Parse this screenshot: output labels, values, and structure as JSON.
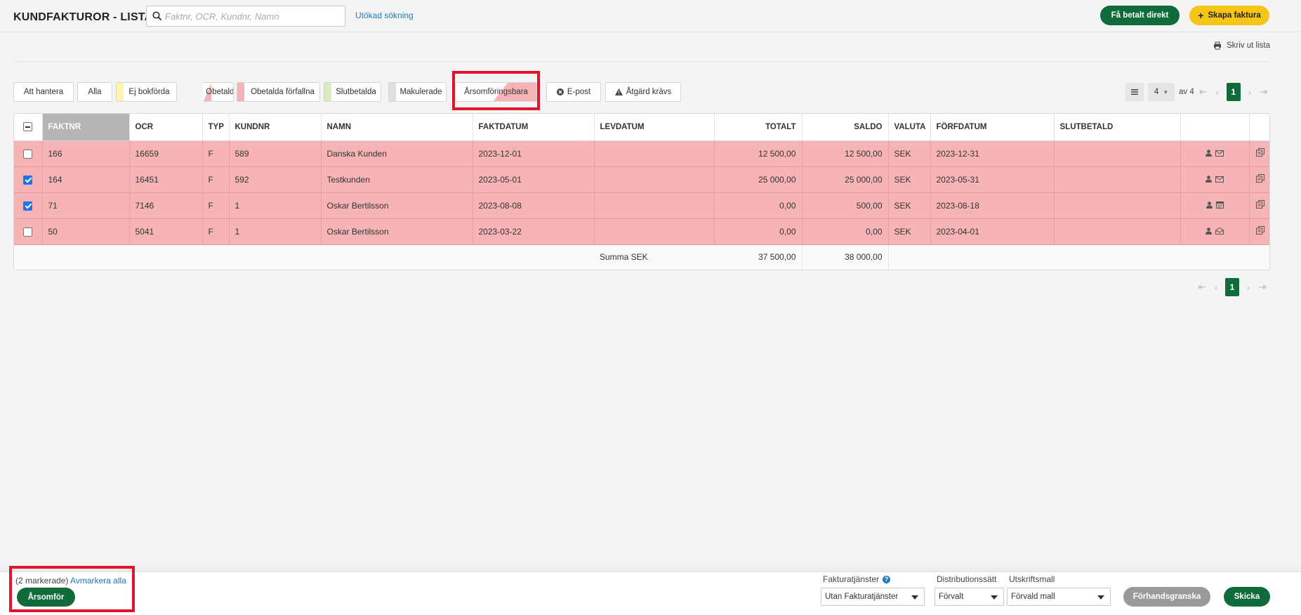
{
  "header": {
    "title": "KUNDFAKTUROR - LISTA",
    "search_placeholder": "Faktnr, OCR, Kundnr, Namn",
    "advanced_search": "Utökad sökning",
    "pay_direct": "Få betalt direkt",
    "create_invoice": "Skapa faktura"
  },
  "print_list": "Skriv ut lista",
  "filters": [
    {
      "label": "Att hantera",
      "color": ""
    },
    {
      "label": "Alla",
      "color": ""
    },
    {
      "label": "Ej bokförda",
      "color": "#fdf2b0"
    },
    {
      "label": "Obetalda",
      "color": "#f7b4b6"
    },
    {
      "label": "Obetalda förfallna",
      "color": "#f7b4b6"
    },
    {
      "label": "Slutbetalda",
      "color": "#d8ecc0"
    },
    {
      "label": "Makulerade",
      "color": "#e0e0e0"
    },
    {
      "label": "Årsomföringsbara",
      "color": "#f7b4b6",
      "selected": true
    },
    {
      "label": "E-post",
      "icon": "x-circle-icon"
    },
    {
      "label": "Åtgärd krävs",
      "icon": "warning-icon"
    }
  ],
  "pager": {
    "page_size": "4",
    "of_label": "av 4",
    "current_page": "1"
  },
  "table": {
    "columns": [
      "FAKTNR",
      "OCR",
      "TYP",
      "KUNDNR",
      "NAMN",
      "FAKTDATUM",
      "LEVDATUM",
      "TOTALT",
      "SALDO",
      "VALUTA",
      "FÖRFDATUM",
      "SLUTBETALD"
    ],
    "rows": [
      {
        "checked": false,
        "faktnr": "166",
        "ocr": "16659",
        "typ": "F",
        "kundnr": "589",
        "namn": "Danska Kunden",
        "faktdatum": "2023-12-01",
        "levdatum": "",
        "totalt": "12 500,00",
        "saldo": "12 500,00",
        "valuta": "SEK",
        "forfdatum": "2023-12-31",
        "slutbetald": "",
        "status_icons": [
          "user-icon",
          "envelope-icon"
        ]
      },
      {
        "checked": true,
        "faktnr": "164",
        "ocr": "16451",
        "typ": "F",
        "kundnr": "592",
        "namn": "Testkunden",
        "faktdatum": "2023-05-01",
        "levdatum": "",
        "totalt": "25 000,00",
        "saldo": "25 000,00",
        "valuta": "SEK",
        "forfdatum": "2023-05-31",
        "slutbetald": "",
        "status_icons": [
          "user-icon",
          "envelope-icon"
        ]
      },
      {
        "checked": true,
        "faktnr": "71",
        "ocr": "7146",
        "typ": "F",
        "kundnr": "1",
        "namn": "Oskar Bertilsson",
        "faktdatum": "2023-08-08",
        "levdatum": "",
        "totalt": "0,00",
        "saldo": "500,00",
        "valuta": "SEK",
        "forfdatum": "2023-08-18",
        "slutbetald": "",
        "status_icons": [
          "user-icon",
          "calendar-icon"
        ]
      },
      {
        "checked": false,
        "faktnr": "50",
        "ocr": "5041",
        "typ": "F",
        "kundnr": "1",
        "namn": "Oskar Bertilsson",
        "faktdatum": "2023-03-22",
        "levdatum": "",
        "totalt": "0,00",
        "saldo": "0,00",
        "valuta": "SEK",
        "forfdatum": "2023-04-01",
        "slutbetald": "",
        "status_icons": [
          "user-icon",
          "envelope-open-icon"
        ]
      }
    ],
    "sum_label": "Summa SEK",
    "sum_totalt": "37 500,00",
    "sum_saldo": "38 000,00"
  },
  "bottom": {
    "marked_count": "(2 markerade)",
    "unmark_all": "Avmarkera alla",
    "action_button": "Årsomför",
    "services_label": "Fakturatjänster",
    "services_value": "Utan Fakturatjänster",
    "distribution_label": "Distributionssätt",
    "distribution_value": "Förvalt",
    "template_label": "Utskriftsmall",
    "template_value": "Förvald mall",
    "preview": "Förhandsgranska",
    "send": "Skicka"
  },
  "colors": {
    "primary_green": "#0f6b3a",
    "accent_yellow": "#f5c518",
    "row_overdue": "#f7b4b6",
    "link_blue": "#1a7bbd",
    "highlight_red": "#e0142a"
  }
}
